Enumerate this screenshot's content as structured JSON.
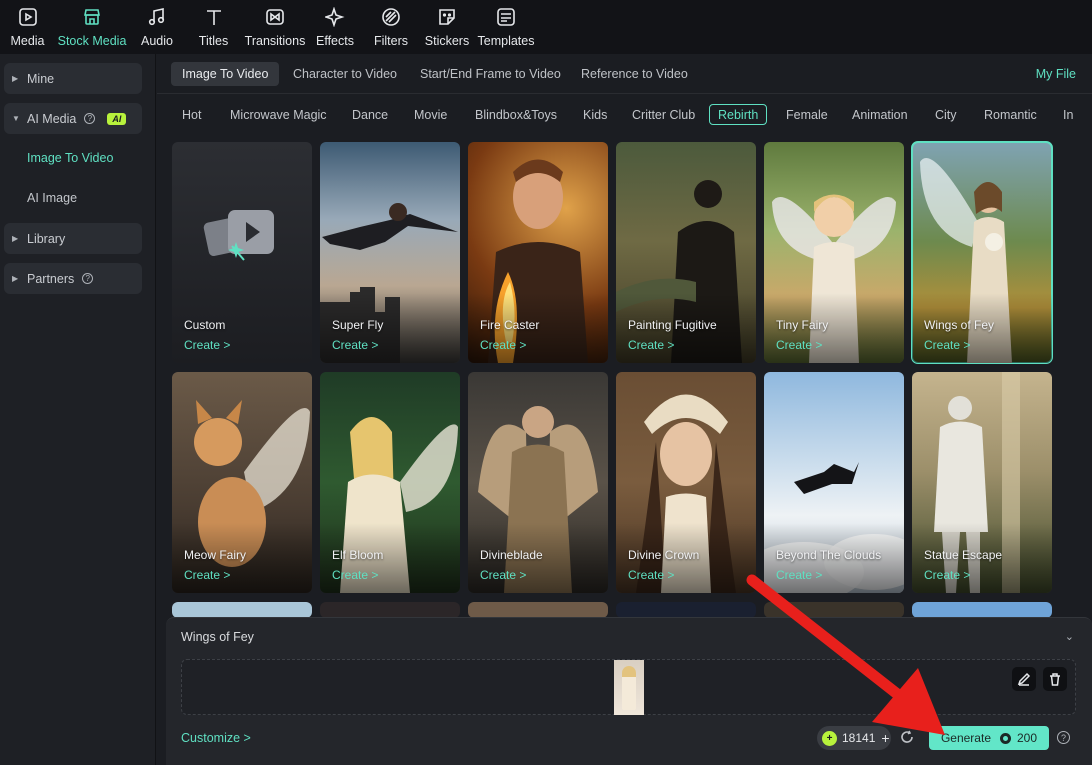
{
  "toolbar": {
    "tools": [
      {
        "label": "Media",
        "icon": "media-icon"
      },
      {
        "label": "Stock Media",
        "icon": "store-icon",
        "active": true
      },
      {
        "label": "Audio",
        "icon": "music-note-icon"
      },
      {
        "label": "Titles",
        "icon": "title-t-icon"
      },
      {
        "label": "Transitions",
        "icon": "transition-icon"
      },
      {
        "label": "Effects",
        "icon": "sparkle-icon"
      },
      {
        "label": "Filters",
        "icon": "filter-icon"
      },
      {
        "label": "Stickers",
        "icon": "sticker-icon"
      },
      {
        "label": "Templates",
        "icon": "template-icon"
      }
    ]
  },
  "sidebar": {
    "mine": "Mine",
    "ai_media": "AI Media",
    "ai_badge": "AI",
    "help_mark": "?",
    "image_to_video": "Image To Video",
    "ai_image": "AI Image",
    "library": "Library",
    "partners": "Partners"
  },
  "subtabs": {
    "items": [
      "Image To Video",
      "Character to Video",
      "Start/End Frame to Video",
      "Reference to Video"
    ],
    "my_file": "My File"
  },
  "categories": [
    "Hot",
    "Microwave Magic",
    "Dance",
    "Movie",
    "Blindbox&Toys",
    "Kids",
    "Critter Club",
    "Rebirth",
    "Female",
    "Animation",
    "City",
    "Romantic",
    "In"
  ],
  "active_category": "Rebirth",
  "cards": [
    {
      "title": "Custom",
      "create": "Create >"
    },
    {
      "title": "Super Fly",
      "create": "Create >"
    },
    {
      "title": "Fire Caster",
      "create": "Create >"
    },
    {
      "title": "Painting Fugitive",
      "create": "Create >"
    },
    {
      "title": "Tiny Fairy",
      "create": "Create >"
    },
    {
      "title": "Wings of Fey",
      "create": "Create >",
      "selected": true
    },
    {
      "title": "Meow Fairy",
      "create": "Create >"
    },
    {
      "title": "Elf Bloom",
      "create": "Create >"
    },
    {
      "title": "Divineblade",
      "create": "Create >"
    },
    {
      "title": "Divine Crown",
      "create": "Create >"
    },
    {
      "title": "Beyond The Clouds",
      "create": "Create >"
    },
    {
      "title": "Statue Escape",
      "create": "Create >"
    }
  ],
  "panel": {
    "title": "Wings of Fey",
    "customize": "Customize >",
    "credits": "18141",
    "generate": "Generate",
    "cost": "200",
    "help_mark": "?"
  },
  "colors": {
    "accent": "#5fe0c2",
    "ai_badge": "#b8f23c",
    "annotation_arrow": "#e8201c"
  }
}
